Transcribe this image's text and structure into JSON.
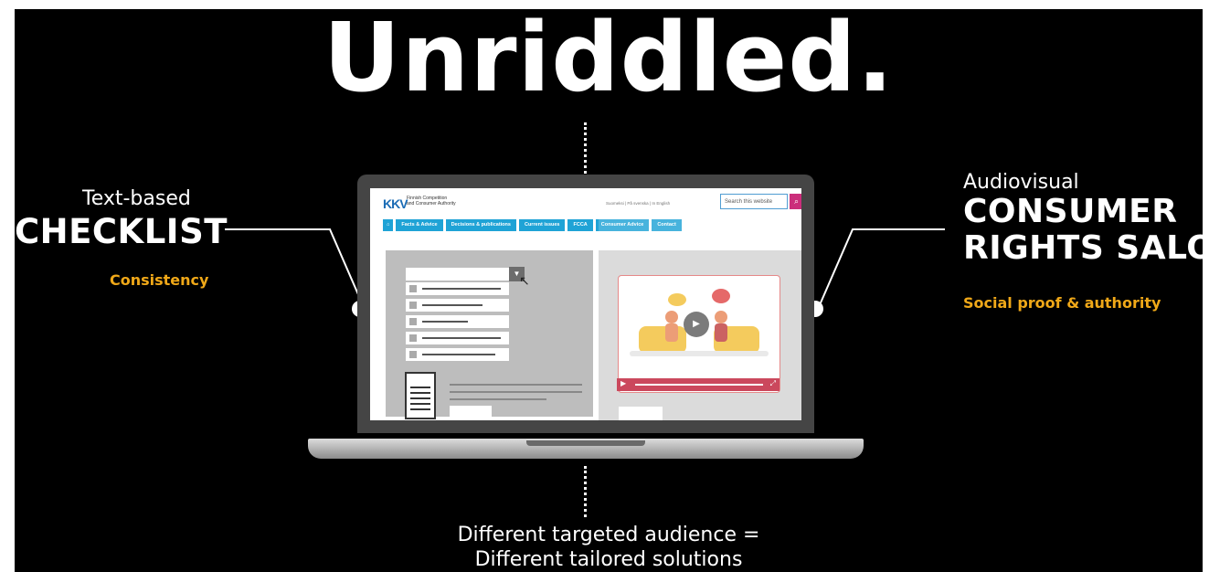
{
  "title": "Unriddled.",
  "left": {
    "small": "Text-based",
    "big": "CHECKLIST",
    "tag": "Consistency"
  },
  "right": {
    "small": "Audiovisual",
    "big_line1": "CONSUMER",
    "big_line2": "RIGHTS SALON",
    "tag": "Social proof & authority"
  },
  "bottom": {
    "line1": "Different targeted audience =",
    "line2": "Different tailored solutions"
  },
  "screen": {
    "logo": "KKV",
    "logo_text_line1": "Finnish Competition",
    "logo_text_line2": "and Consumer Authority",
    "languages": "Suomeksi | På svenska | In English",
    "search_placeholder": "Search this website",
    "nav": [
      "Facts & Advice",
      "Decisions & publications",
      "Current issues",
      "FCCA",
      "Consumer Advice",
      "Contact"
    ]
  },
  "colors": {
    "background": "#000000",
    "accent": "#f0a818",
    "nav_blue": "#1fa3d6",
    "search_magenta": "#c0005e",
    "video_red": "#c0203a"
  },
  "icons": [
    "home-icon",
    "search-icon",
    "cursor-icon",
    "document-icon",
    "play-icon",
    "fullscreen-icon"
  ]
}
